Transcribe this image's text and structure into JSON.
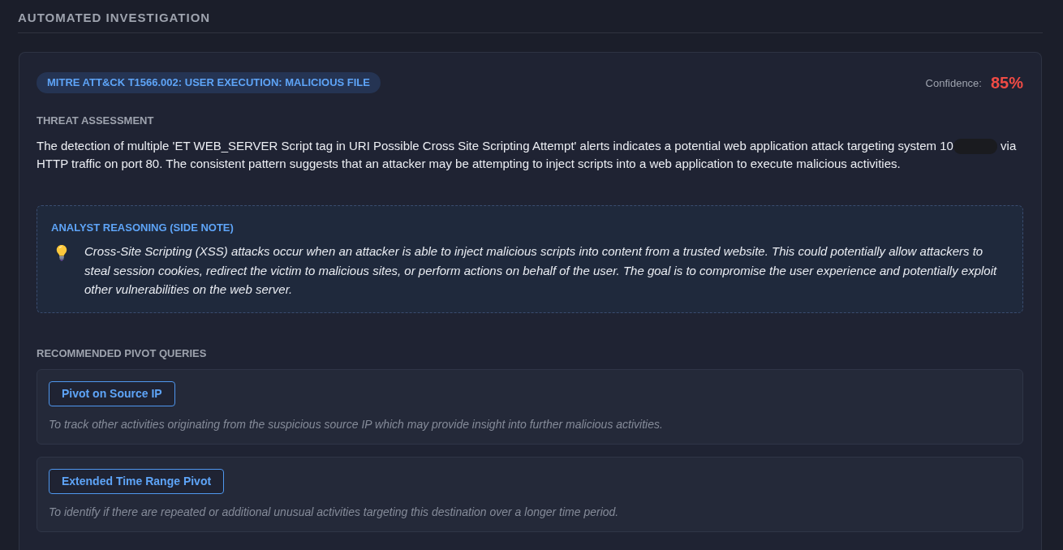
{
  "section": {
    "title": "AUTOMATED INVESTIGATION"
  },
  "investigation": {
    "technique_badge": "MITRE ATT&CK T1566.002: USER EXECUTION: MALICIOUS FILE",
    "confidence": {
      "label": "Confidence:",
      "value": "85%"
    },
    "threat_assessment": {
      "label": "THREAT ASSESSMENT",
      "text_parts": [
        "The detection of multiple 'ET WEB_SERVER Script tag in URI Possible Cross Site Scripting Attempt' alerts indicates a potential web application attack targeting system 10",
        "via HTTP traffic on port 80. The consistent pattern suggests that an attacker may be attempting to inject scripts into a web application to execute malicious activities."
      ],
      "redacted": true
    },
    "side_note": {
      "title": "ANALYST REASONING (SIDE NOTE)",
      "text": "Cross-Site Scripting (XSS) attacks occur when an attacker is able to inject malicious scripts into content from a trusted website. This could potentially allow attackers to steal session cookies, redirect the victim to malicious sites, or perform actions on behalf of the user. The goal is to compromise the user experience and potentially exploit other vulnerabilities on the web server."
    },
    "pivot_queries": {
      "label": "RECOMMENDED PIVOT QUERIES",
      "items": [
        {
          "button": "Pivot on Source IP",
          "description": "To track other activities originating from the suspicious source IP which may provide insight into further malicious activities."
        },
        {
          "button": "Extended Time Range Pivot",
          "description": "To identify if there are repeated or additional unusual activities targeting this destination over a longer time period."
        }
      ]
    }
  }
}
